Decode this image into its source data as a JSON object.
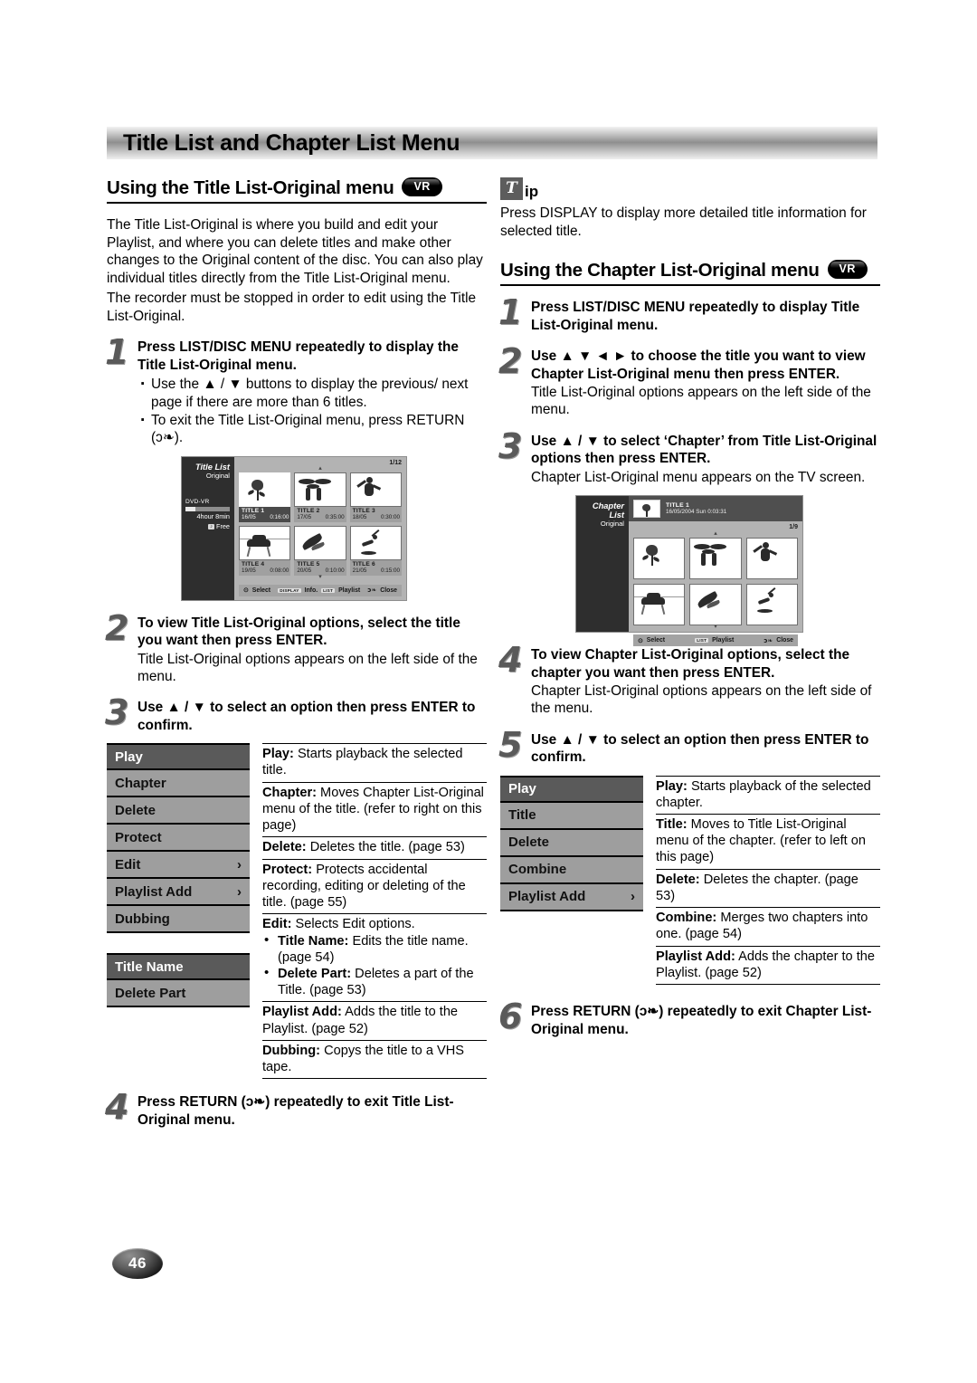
{
  "banner": {
    "title": "Title List and Chapter List Menu"
  },
  "page_number": "46",
  "left": {
    "heading": "Using the Title List-Original menu",
    "badge": "VR",
    "intro_1": "The Title List-Original is where you build and edit your Playlist, and where you can delete titles and make other changes to the Original content of the disc. You can also play individual titles directly from the Title List-Original menu.",
    "intro_2": "The recorder must be stopped in order to edit using the Title List-Original.",
    "step1": {
      "num": "1",
      "title": "Press LIST/DISC MENU repeatedly to display the Title List-Original menu.",
      "bullets": [
        "Use the ▲ / ▼ buttons to display the previous/ next page if there are more than 6 titles.",
        "To exit the Title List-Original menu, press RETURN (ↄ❧)."
      ]
    },
    "step2": {
      "num": "2",
      "title": "To view Title List-Original options, select the title you want then press ENTER.",
      "body": "Title List-Original options appears on the left side of the menu."
    },
    "step3": {
      "num": "3",
      "title": "Use ▲ / ▼ to select an option then press ENTER to confirm."
    },
    "step4": {
      "num": "4",
      "title": "Press RETURN (ↄ❧) repeatedly to exit Title List-Original menu."
    },
    "menu": [
      {
        "label": "Play",
        "selected": true,
        "chevron": ""
      },
      {
        "label": "Chapter",
        "selected": false,
        "chevron": ""
      },
      {
        "label": "Delete",
        "selected": false,
        "chevron": ""
      },
      {
        "label": "Protect",
        "selected": false,
        "chevron": ""
      },
      {
        "label": "Edit",
        "selected": false,
        "chevron": "›"
      },
      {
        "label": "Playlist Add",
        "selected": false,
        "chevron": "›"
      },
      {
        "label": "Dubbing",
        "selected": false,
        "chevron": ""
      }
    ],
    "submenu": [
      {
        "label": "Title Name",
        "selected": true
      },
      {
        "label": "Delete Part",
        "selected": false
      }
    ],
    "descriptions": [
      {
        "term": "Play:",
        "text": " Starts playback the selected title."
      },
      {
        "term": "Chapter:",
        "text": " Moves Chapter List-Original menu of the title. (refer to right on this page)"
      },
      {
        "term": "Delete:",
        "text": " Deletes the title. (page 53)"
      },
      {
        "term": "Protect:",
        "text": " Protects accidental recording, editing or deleting of the title. (page 55)"
      },
      {
        "term": "Edit:",
        "text": " Selects Edit options.",
        "sub": [
          {
            "term": "Title Name:",
            "text": " Edits the title name. (page 54)"
          },
          {
            "term": "Delete Part:",
            "text": " Deletes a part of the Title. (page 53)"
          }
        ]
      },
      {
        "term": "Playlist Add:",
        "text": " Adds the title to the Playlist. (page 52)"
      },
      {
        "term": "Dubbing:",
        "text": " Copys the title to a VHS tape."
      }
    ]
  },
  "tip": {
    "glyph": "T",
    "label": "ip",
    "text": "Press DISPLAY to display more detailed title information for selected title."
  },
  "right": {
    "heading": "Using the Chapter List-Original menu",
    "badge": "VR",
    "step1": {
      "num": "1",
      "title": "Press LIST/DISC MENU repeatedly to display Title List-Original menu."
    },
    "step2": {
      "num": "2",
      "title": "Use ▲ ▼ ◄ ► to choose the title you want to view Chapter List-Original menu then press ENTER.",
      "body": "Title List-Original options appears on the left side of the menu."
    },
    "step3": {
      "num": "3",
      "title": "Use ▲ / ▼ to select ‘Chapter’ from Title List-Original options then press ENTER.",
      "body": "Chapter List-Original menu appears on the TV screen."
    },
    "step4": {
      "num": "4",
      "title": "To view Chapter List-Original options, select the chapter you want then press ENTER.",
      "body": "Chapter List-Original options appears on the left side of the menu."
    },
    "step5": {
      "num": "5",
      "title": "Use ▲ / ▼ to select an option then press ENTER to confirm."
    },
    "step6": {
      "num": "6",
      "title": "Press RETURN (ↄ❧) repeatedly to exit Chapter List-Original menu."
    },
    "menu": [
      {
        "label": "Play",
        "selected": true,
        "chevron": ""
      },
      {
        "label": "Title",
        "selected": false,
        "chevron": ""
      },
      {
        "label": "Delete",
        "selected": false,
        "chevron": ""
      },
      {
        "label": "Combine",
        "selected": false,
        "chevron": ""
      },
      {
        "label": "Playlist Add",
        "selected": false,
        "chevron": "›"
      }
    ],
    "descriptions": [
      {
        "term": "Play:",
        "text": " Starts playback of the selected chapter."
      },
      {
        "term": "Title:",
        "text": " Moves to Title List-Original menu of the chapter. (refer to left on this page)"
      },
      {
        "term": "Delete:",
        "text": " Deletes the chapter. (page 53)"
      },
      {
        "term": "Combine:",
        "text": " Merges two chapters into one. (page 54)"
      },
      {
        "term": "Playlist Add:",
        "text": " Adds the chapter to the Playlist. (page 52)"
      }
    ]
  },
  "title_list_screen": {
    "side_title": "Title List",
    "side_sub": "Original",
    "disc_type": "DVD-VR",
    "free_time": "4hour 8min",
    "free_chip": "♪",
    "free_label": "Free",
    "page_indicator": "1/12",
    "up_arrow": "▴",
    "down_arrow": "▾",
    "items": [
      {
        "title": "TITLE 1",
        "date": "16/05",
        "time": "0:16:00",
        "art": "art-rose",
        "selected": true
      },
      {
        "title": "TITLE 2",
        "date": "17/05",
        "time": "0:35:00",
        "art": "art-tree",
        "selected": false
      },
      {
        "title": "TITLE 3",
        "date": "18/05",
        "time": "0:30:00",
        "art": "art-fig",
        "selected": false
      },
      {
        "title": "TITLE 4",
        "date": "19/05",
        "time": "0:08:00",
        "art": "art-car",
        "selected": false
      },
      {
        "title": "TITLE 5",
        "date": "20/05",
        "time": "0:10:00",
        "art": "art-shuttle",
        "selected": false
      },
      {
        "title": "TITLE 6",
        "date": "21/05",
        "time": "0:15:00",
        "art": "art-surf",
        "selected": false
      }
    ],
    "status": {
      "select": "Select",
      "select_icon": "⊙",
      "display_key": "DISPLAY",
      "display_label": "Info.",
      "list_key": "LIST",
      "list_label": "Playlist",
      "close_icon": "ↄ❧",
      "close_label": "Close"
    }
  },
  "chapter_list_screen": {
    "side_title": "Chapter List",
    "side_sub": "Original",
    "header_title": "TITLE 1",
    "header_info": "16/05/2004  Sun 0:03:31",
    "page_indicator": "1/9",
    "up_arrow": "▴",
    "down_arrow": "▾",
    "items": [
      {
        "art": "art-rose"
      },
      {
        "art": "art-tree"
      },
      {
        "art": "art-fig"
      },
      {
        "art": "art-car"
      },
      {
        "art": "art-shuttle"
      },
      {
        "art": "art-surf"
      }
    ],
    "status": {
      "select": "Select",
      "select_icon": "⊙",
      "list_key": "LIST",
      "list_label": "Playlist",
      "close_icon": "ↄ❧",
      "close_label": "Close"
    }
  }
}
